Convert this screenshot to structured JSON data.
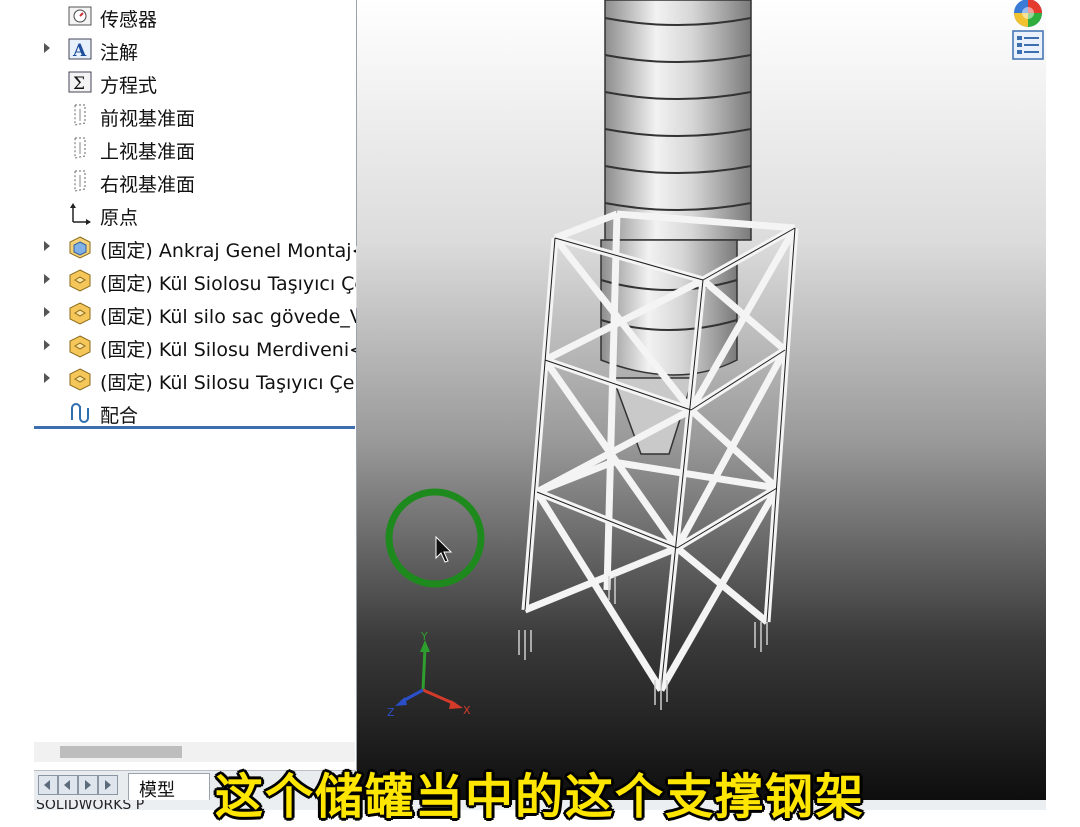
{
  "feature_tree": {
    "items": [
      {
        "label": "传感器",
        "icon": "sensor-icon",
        "expandable": false
      },
      {
        "label": "注解",
        "icon": "annotation-icon",
        "expandable": true
      },
      {
        "label": "方程式",
        "icon": "equation-icon",
        "expandable": false
      },
      {
        "label": "前视基准面",
        "icon": "plane-icon",
        "expandable": false
      },
      {
        "label": "上视基准面",
        "icon": "plane-icon",
        "expandable": false
      },
      {
        "label": "右视基准面",
        "icon": "plane-icon",
        "expandable": false
      },
      {
        "label": "原点",
        "icon": "origin-icon",
        "expandable": false
      },
      {
        "label": "(固定) Ankraj Genel Montaj<",
        "icon": "subassembly-icon",
        "expandable": true
      },
      {
        "label": "(固定) Kül Siolosu Taşıyıcı Çe",
        "icon": "part-icon",
        "expandable": true
      },
      {
        "label": "(固定) Kül silo sac gövede_Va",
        "icon": "part-icon",
        "expandable": true
      },
      {
        "label": "(固定) Kül Silosu Merdiveni<",
        "icon": "part-icon",
        "expandable": true
      },
      {
        "label": "(固定) Kül Silosu Taşıyıcı Çel",
        "icon": "part-icon",
        "expandable": true
      },
      {
        "label": "配合",
        "icon": "mates-icon",
        "expandable": false
      }
    ]
  },
  "bottom_tabs": {
    "model_tab": "模型"
  },
  "status_bar": {
    "text": "SOLIDWORKS P"
  },
  "viewport": {
    "triad_labels": {
      "x": "X",
      "y": "Y",
      "z": "Z"
    },
    "background_top": "#ffffff",
    "background_bottom": "#0e0e0e"
  },
  "subtitle": "这个储罐当中的这个支撑钢架",
  "colors": {
    "subtitle": "#ffe600",
    "tree_rule": "#3d6fb0",
    "cursor_ring": "#1e8a1e"
  }
}
